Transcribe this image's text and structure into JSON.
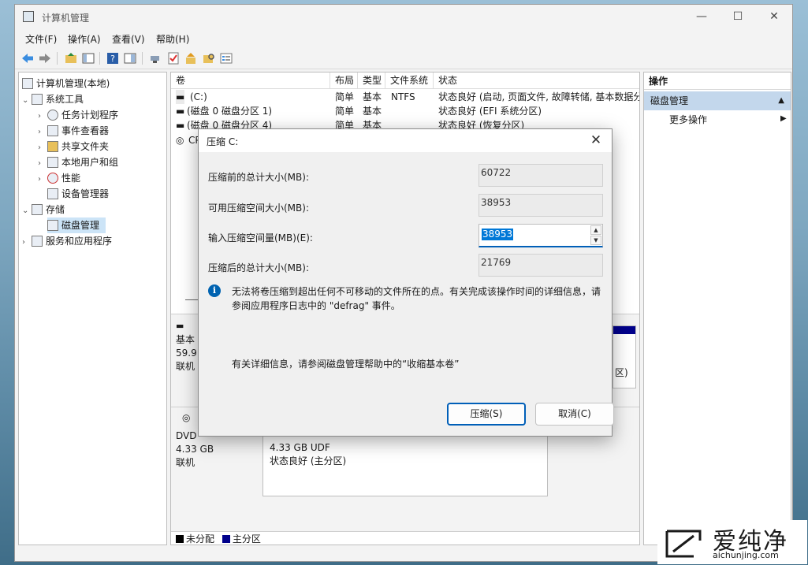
{
  "window": {
    "title": "计算机管理",
    "minimize": "—",
    "maximize": "☐",
    "close": "✕"
  },
  "menu": [
    "文件(F)",
    "操作(A)",
    "查看(V)",
    "帮助(H)"
  ],
  "tree": [
    {
      "label": "计算机管理(本地)",
      "arrow": "",
      "level": 0
    },
    {
      "label": "系统工具",
      "arrow": "⌄",
      "level": 1
    },
    {
      "label": "任务计划程序",
      "arrow": "›",
      "level": 2
    },
    {
      "label": "事件查看器",
      "arrow": "›",
      "level": 2
    },
    {
      "label": "共享文件夹",
      "arrow": "›",
      "level": 2
    },
    {
      "label": "本地用户和组",
      "arrow": "›",
      "level": 2
    },
    {
      "label": "性能",
      "arrow": "›",
      "level": 2
    },
    {
      "label": "设备管理器",
      "arrow": "",
      "level": 2
    },
    {
      "label": "存储",
      "arrow": "⌄",
      "level": 1
    },
    {
      "label": "磁盘管理",
      "arrow": "",
      "level": 2
    },
    {
      "label": "服务和应用程序",
      "arrow": "›",
      "level": 1
    }
  ],
  "volume_table": {
    "headers": [
      "卷",
      "布局",
      "类型",
      "文件系统",
      "状态"
    ],
    "rows": [
      [
        "(C:)",
        "简单",
        "基本",
        "NTFS",
        "状态良好 (启动, 页面文件, 故障转储, 基本数据分"
      ],
      [
        "(磁盘 0 磁盘分区 1)",
        "简单",
        "基本",
        "",
        "状态良好 (EFI 系统分区)"
      ],
      [
        "(磁盘 0 磁盘分区 4)",
        "简单",
        "基本",
        "",
        "状态良好 (恢复分区)"
      ],
      [
        "CP",
        "",
        "",
        "",
        ""
      ]
    ]
  },
  "disks": [
    {
      "name": "基本",
      "size": "59.9",
      "status": "联机"
    },
    {
      "name": "DVD",
      "size": "4.33 GB",
      "status": "联机",
      "partition_size": "4.33 GB UDF",
      "partition_status": "状态良好 (主分区)",
      "partition_close": "区)"
    }
  ],
  "legend": [
    {
      "label": "未分配",
      "color": "#000000"
    },
    {
      "label": "主分区",
      "color": "#00008b"
    }
  ],
  "actions": {
    "header": "操作",
    "selected": "磁盘管理",
    "more": "更多操作"
  },
  "dialog": {
    "title": "压缩 C:",
    "total_before_label": "压缩前的总计大小(MB):",
    "total_before_value": "60722",
    "available_label": "可用压缩空间大小(MB):",
    "available_value": "38953",
    "input_label": "输入压缩空间量(MB)(E):",
    "input_value": "38953",
    "total_after_label": "压缩后的总计大小(MB):",
    "total_after_value": "21769",
    "info_text": "无法将卷压缩到超出任何不可移动的文件所在的点。有关完成该操作时间的详细信息，请参阅应用程序日志中的 \"defrag\" 事件。",
    "more_info": "有关详细信息，请参阅磁盘管理帮助中的“收缩基本卷”",
    "shrink_button": "压缩(S)",
    "cancel_button": "取消(C)"
  },
  "watermark": {
    "brand": "爱纯净",
    "url": "aichunjing.com"
  },
  "colors": {
    "accent": "#005fb8",
    "selection": "#0078d7",
    "action_selected": "#c3d7ec"
  }
}
